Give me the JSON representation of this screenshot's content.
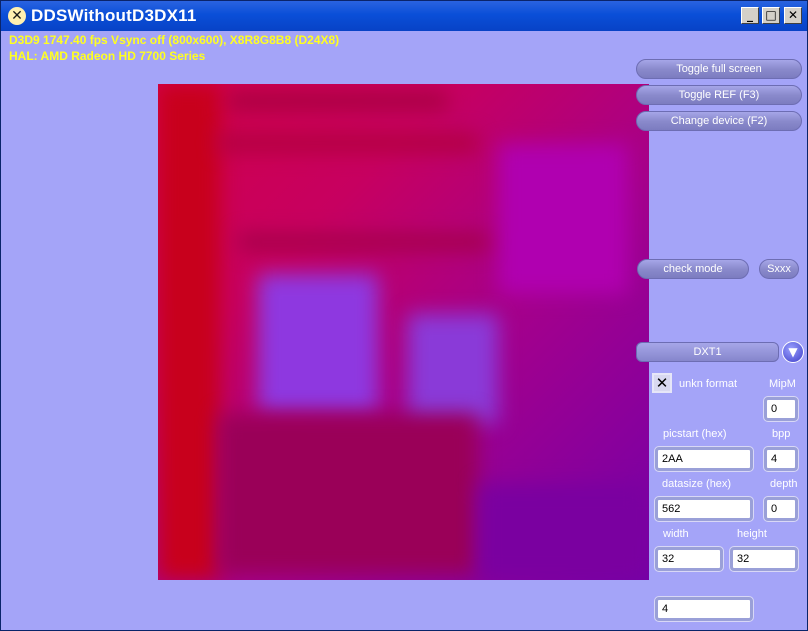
{
  "window": {
    "title": "DDSWithoutD3DX11"
  },
  "titlebar_buttons": {
    "minimize": "_",
    "maximize": "□",
    "close": "✕",
    "app_icon": "✕"
  },
  "stats": {
    "line1": "D3D9 1747.40 fps Vsync off (800x600), X8R8G8B8 (D24X8)",
    "line2": "HAL: AMD Radeon HD 7700 Series"
  },
  "buttons": {
    "toggle_fullscreen": "Toggle full screen",
    "toggle_ref": "Toggle REF (F3)",
    "change_device": "Change device (F2)",
    "check_mode": "check mode",
    "sxxx": "Sxxx"
  },
  "format_combo": {
    "selected": "DXT1",
    "arrow_icon": "▼"
  },
  "unkn_format": {
    "label": "unkn format",
    "checked": true,
    "mark": "✕"
  },
  "fields": {
    "mipm": {
      "label": "MipM",
      "value": "0"
    },
    "picstart": {
      "label": "picstart  (hex)",
      "value": "2AA"
    },
    "bpp": {
      "label": "bpp",
      "value": "4"
    },
    "datasize": {
      "label": "datasize  (hex)",
      "value": "562"
    },
    "depth": {
      "label": "depth",
      "value": "0"
    },
    "width": {
      "label": "width",
      "value": "32"
    },
    "height": {
      "label": "height",
      "value": "32"
    },
    "extra": {
      "value": "4"
    }
  },
  "colors": {
    "client_bg": "#a4a4f8",
    "stats_text": "#ffff20",
    "titlebar": "#0a4fd8"
  }
}
